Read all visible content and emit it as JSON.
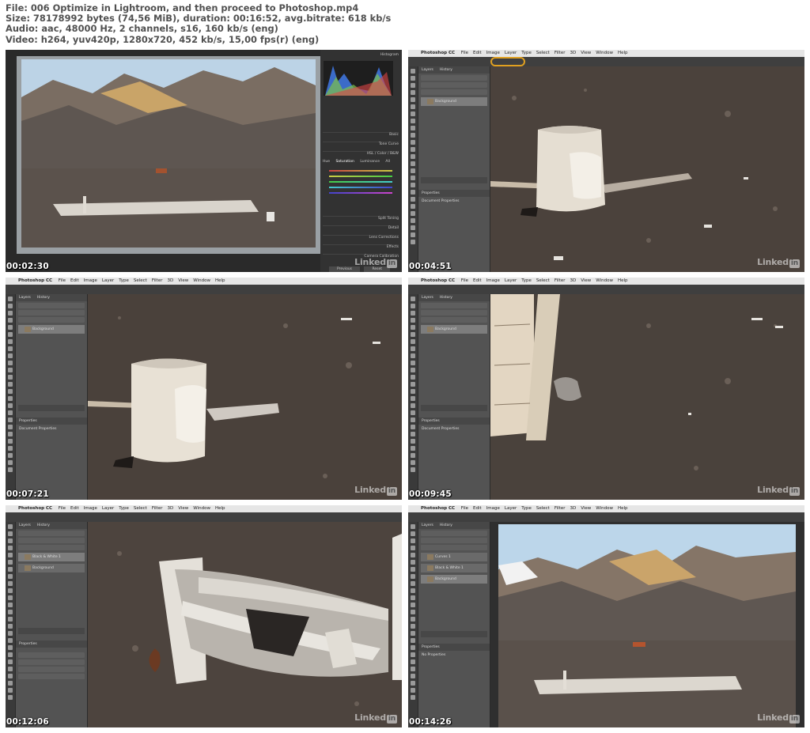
{
  "header": {
    "file_line": "File: 006 Optimize in Lightroom, and then proceed to Photoshop.mp4",
    "size_line": "Size: 78178992 bytes (74,56 MiB), duration: 00:16:52, avg.bitrate: 618 kb/s",
    "audio_line": "Audio: aac, 48000 Hz, 2 channels, s16, 160 kb/s (eng)",
    "video_line": "Video: h264, yuv420p, 1280x720, 452 kb/s, 15,00 fps(r) (eng)"
  },
  "watermark": {
    "text": "Linked",
    "badge": "in"
  },
  "photoshop": {
    "app": "Photoshop CC",
    "menus": [
      "File",
      "Edit",
      "Image",
      "Layer",
      "Type",
      "Select",
      "Filter",
      "3D",
      "View",
      "Window",
      "Help"
    ],
    "tabs_layers": [
      "Layers",
      "History"
    ],
    "tabs_properties": [
      "Properties"
    ],
    "layer_background": "Background",
    "doc_props": "Document Properties",
    "layer_curves": "Curves 1",
    "layer_bw": "Black & White 1",
    "no_props": "No Properties"
  },
  "lightroom": {
    "panels": [
      "Histogram",
      "Basic",
      "Tone Curve",
      "HSL / Color / B&W",
      "Split Toning",
      "Detail",
      "Lens Corrections",
      "Effects",
      "Camera Calibration"
    ],
    "hsl_tabs": [
      "Hue",
      "Saturation",
      "Luminance",
      "All"
    ],
    "buttons": [
      "Previous",
      "Reset"
    ]
  },
  "thumbnails": [
    {
      "timestamp": "00:02:30"
    },
    {
      "timestamp": "00:04:51"
    },
    {
      "timestamp": "00:07:21"
    },
    {
      "timestamp": "00:09:45"
    },
    {
      "timestamp": "00:12:06"
    },
    {
      "timestamp": "00:14:26"
    }
  ]
}
